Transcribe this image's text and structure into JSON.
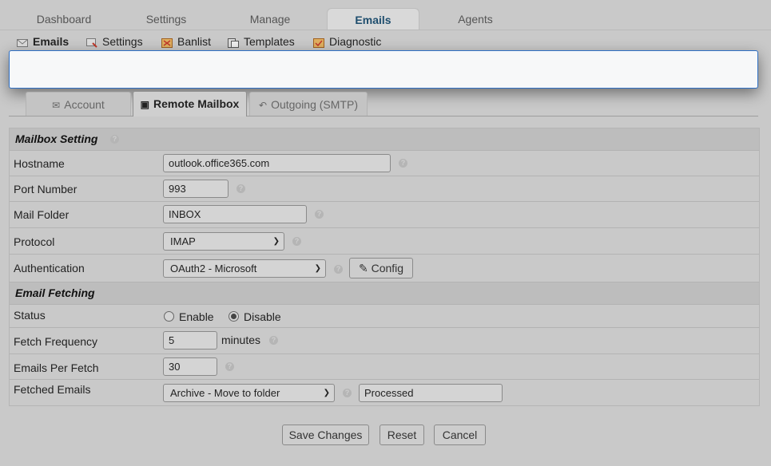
{
  "top_tabs": [
    {
      "label": "Dashboard",
      "active": false
    },
    {
      "label": "Settings",
      "active": false
    },
    {
      "label": "Manage",
      "active": false
    },
    {
      "label": "Emails",
      "active": true
    },
    {
      "label": "Agents",
      "active": false
    }
  ],
  "sub_tabs": [
    {
      "label": "Emails",
      "icon": "envelope-icon",
      "active": true
    },
    {
      "label": "Settings",
      "icon": "settings-icon",
      "active": false
    },
    {
      "label": "Banlist",
      "icon": "banlist-icon",
      "active": false
    },
    {
      "label": "Templates",
      "icon": "templates-icon",
      "active": false
    },
    {
      "label": "Diagnostic",
      "icon": "diagnostic-icon",
      "active": false
    }
  ],
  "settings_tabs": [
    {
      "label": "Account",
      "icon": "envelope-icon",
      "active": false
    },
    {
      "label": "Remote Mailbox",
      "icon": "inbox-icon",
      "active": true
    },
    {
      "label": "Outgoing (SMTP)",
      "icon": "reply-icon",
      "active": false
    }
  ],
  "mailbox": {
    "section_title": "Mailbox Setting",
    "hostname_label": "Hostname",
    "hostname_value": "outlook.office365.com",
    "port_label": "Port Number",
    "port_value": "993",
    "folder_label": "Mail Folder",
    "folder_value": "INBOX",
    "protocol_label": "Protocol",
    "protocol_value": "IMAP",
    "auth_label": "Authentication",
    "auth_value": "OAuth2 - Microsoft",
    "config_label": "Config"
  },
  "fetching": {
    "section_title": "Email Fetching",
    "status_label": "Status",
    "enable_label": "Enable",
    "disable_label": "Disable",
    "status_selected": "Disable",
    "frequency_label": "Fetch Frequency",
    "frequency_value": "5",
    "frequency_unit": "minutes",
    "per_fetch_label": "Emails Per Fetch",
    "per_fetch_value": "30",
    "fetched_label": "Fetched Emails",
    "fetched_action": "Archive - Move to folder",
    "fetched_folder": "Processed"
  },
  "actions": {
    "save": "Save Changes",
    "reset": "Reset",
    "cancel": "Cancel"
  },
  "colors": {
    "active_tab_text": "#1f4e6e",
    "overlay_border": "#2e6fc4"
  }
}
